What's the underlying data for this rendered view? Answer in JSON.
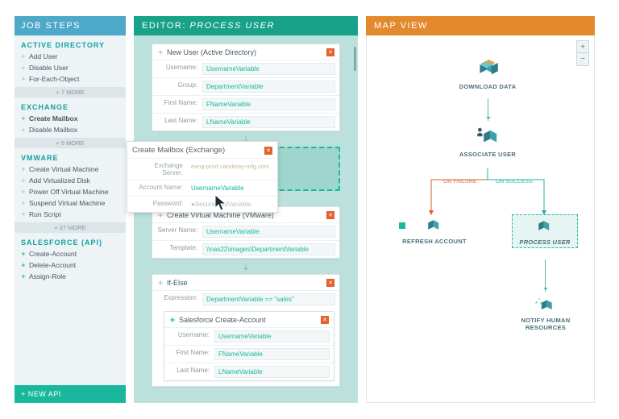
{
  "jobsteps": {
    "header": "JOB STEPS",
    "sections": [
      {
        "title": "ACTIVE DIRECTORY",
        "items": [
          "Add User",
          "Disable User",
          "For-Each-Object"
        ],
        "more": "+ 7 MORE"
      },
      {
        "title": "EXCHANGE",
        "items": [
          "Create Mailbox",
          "Disable Mailbox"
        ],
        "bold_index": 0,
        "more": "+ 5 MORE"
      },
      {
        "title": "VMWARE",
        "items": [
          "Create Virtual Machine",
          "Add Virtualized Disk",
          "Power Off Virtual Machine",
          "Suspend Virtual Machine",
          "Run Script"
        ],
        "more": "+ 27 MORE"
      },
      {
        "title": "SALESFORCE (API)",
        "items": [
          "Create-Account",
          "Delete-Account",
          "Assign-Role"
        ],
        "api": true
      }
    ],
    "newapi": "+ NEW API"
  },
  "editor": {
    "header_label": "EDITOR:",
    "header_value": "PROCESS USER",
    "cards": {
      "newuser": {
        "title": "New User (Active Directory)",
        "rows": [
          [
            "Username:",
            "UsernameVariable"
          ],
          [
            "Group:",
            "DepartmentVariable"
          ],
          [
            "First Name:",
            "FNameVariable"
          ],
          [
            "Last Name:",
            "LNameVariable"
          ]
        ]
      },
      "mailbox": {
        "title": "Create Mailbox (Exchange)",
        "rows": [
          [
            "Exchange Server:",
            "exng-prod.vandelay-mfg.com"
          ],
          [
            "Account Name:",
            "UsernameVariable"
          ],
          [
            "Password:",
            "●SecurePwdVariable"
          ]
        ]
      },
      "vmware": {
        "title": "Create Virtual Machine (VMware)",
        "rows": [
          [
            "Server Name:",
            "UsernameVariable"
          ],
          [
            "Template:",
            "\\\\nas22\\images\\DepartmentVariable"
          ]
        ]
      },
      "ifelse": {
        "title": "If-Else",
        "expr_k": "Expression:",
        "expr_v": "DepartmentVariable == \"sales\"",
        "inner_title": "Salesforce Create-Account",
        "inner_rows": [
          [
            "Username:",
            "UsernameVariable"
          ],
          [
            "First Name:",
            "FNameVariable"
          ],
          [
            "Last Name:",
            "LNameVariable"
          ]
        ]
      }
    }
  },
  "map": {
    "header": "MAP VIEW",
    "nodes": {
      "download": "DOWNLOAD DATA",
      "associate": "ASSOCIATE USER",
      "refresh": "REFRESH ACCOUNT",
      "process": "PROCESS USER",
      "notify": "NOTIFY HUMAN\nRESOURCES"
    },
    "branch": {
      "fail": "ON FAILURE",
      "succ": "ON SUCCESS"
    }
  }
}
